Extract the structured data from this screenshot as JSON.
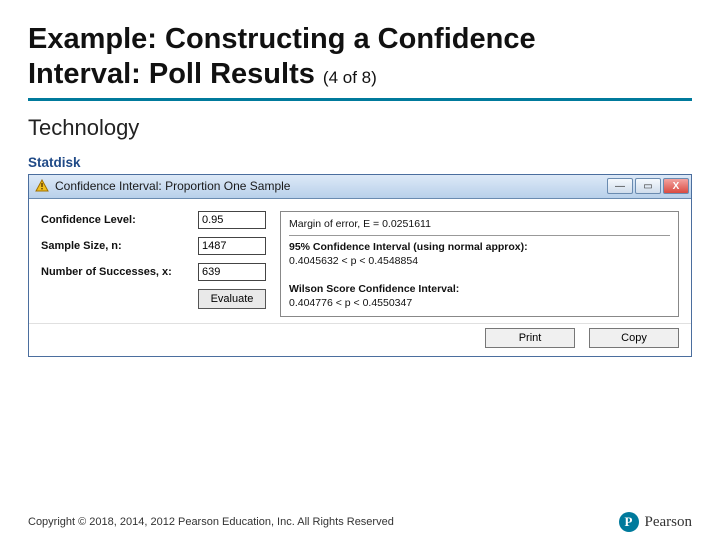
{
  "slide": {
    "title_line1": "Example: Constructing a Confidence",
    "title_line2": "Interval: Poll Results",
    "page_indicator": "(4 of 8)",
    "section": "Technology"
  },
  "app_name": "Statdisk",
  "window": {
    "title": "Confidence Interval: Proportion One Sample",
    "icon_glyph": "⚠",
    "minimize_glyph": "—",
    "maximize_glyph": "▭",
    "close_glyph": "X"
  },
  "inputs": {
    "confidence_label": "Confidence Level:",
    "confidence_value": "0.95",
    "sample_label": "Sample Size, n:",
    "sample_value": "1487",
    "success_label": "Number of Successes, x:",
    "success_value": "639",
    "evaluate_label": "Evaluate"
  },
  "results": {
    "margin_line": "Margin of error, E = 0.0251611",
    "ci_header": "95% Confidence Interval (using normal approx):",
    "ci_line": "0.4045632 < p < 0.4548854",
    "wilson_header": "Wilson Score Confidence Interval:",
    "wilson_line": "0.404776 < p < 0.4550347"
  },
  "buttons": {
    "print": "Print",
    "copy": "Copy"
  },
  "footer": {
    "copyright": "Copyright © 2018, 2014, 2012 Pearson Education, Inc. All Rights Reserved",
    "brand_letter": "P",
    "brand_name": "Pearson"
  }
}
